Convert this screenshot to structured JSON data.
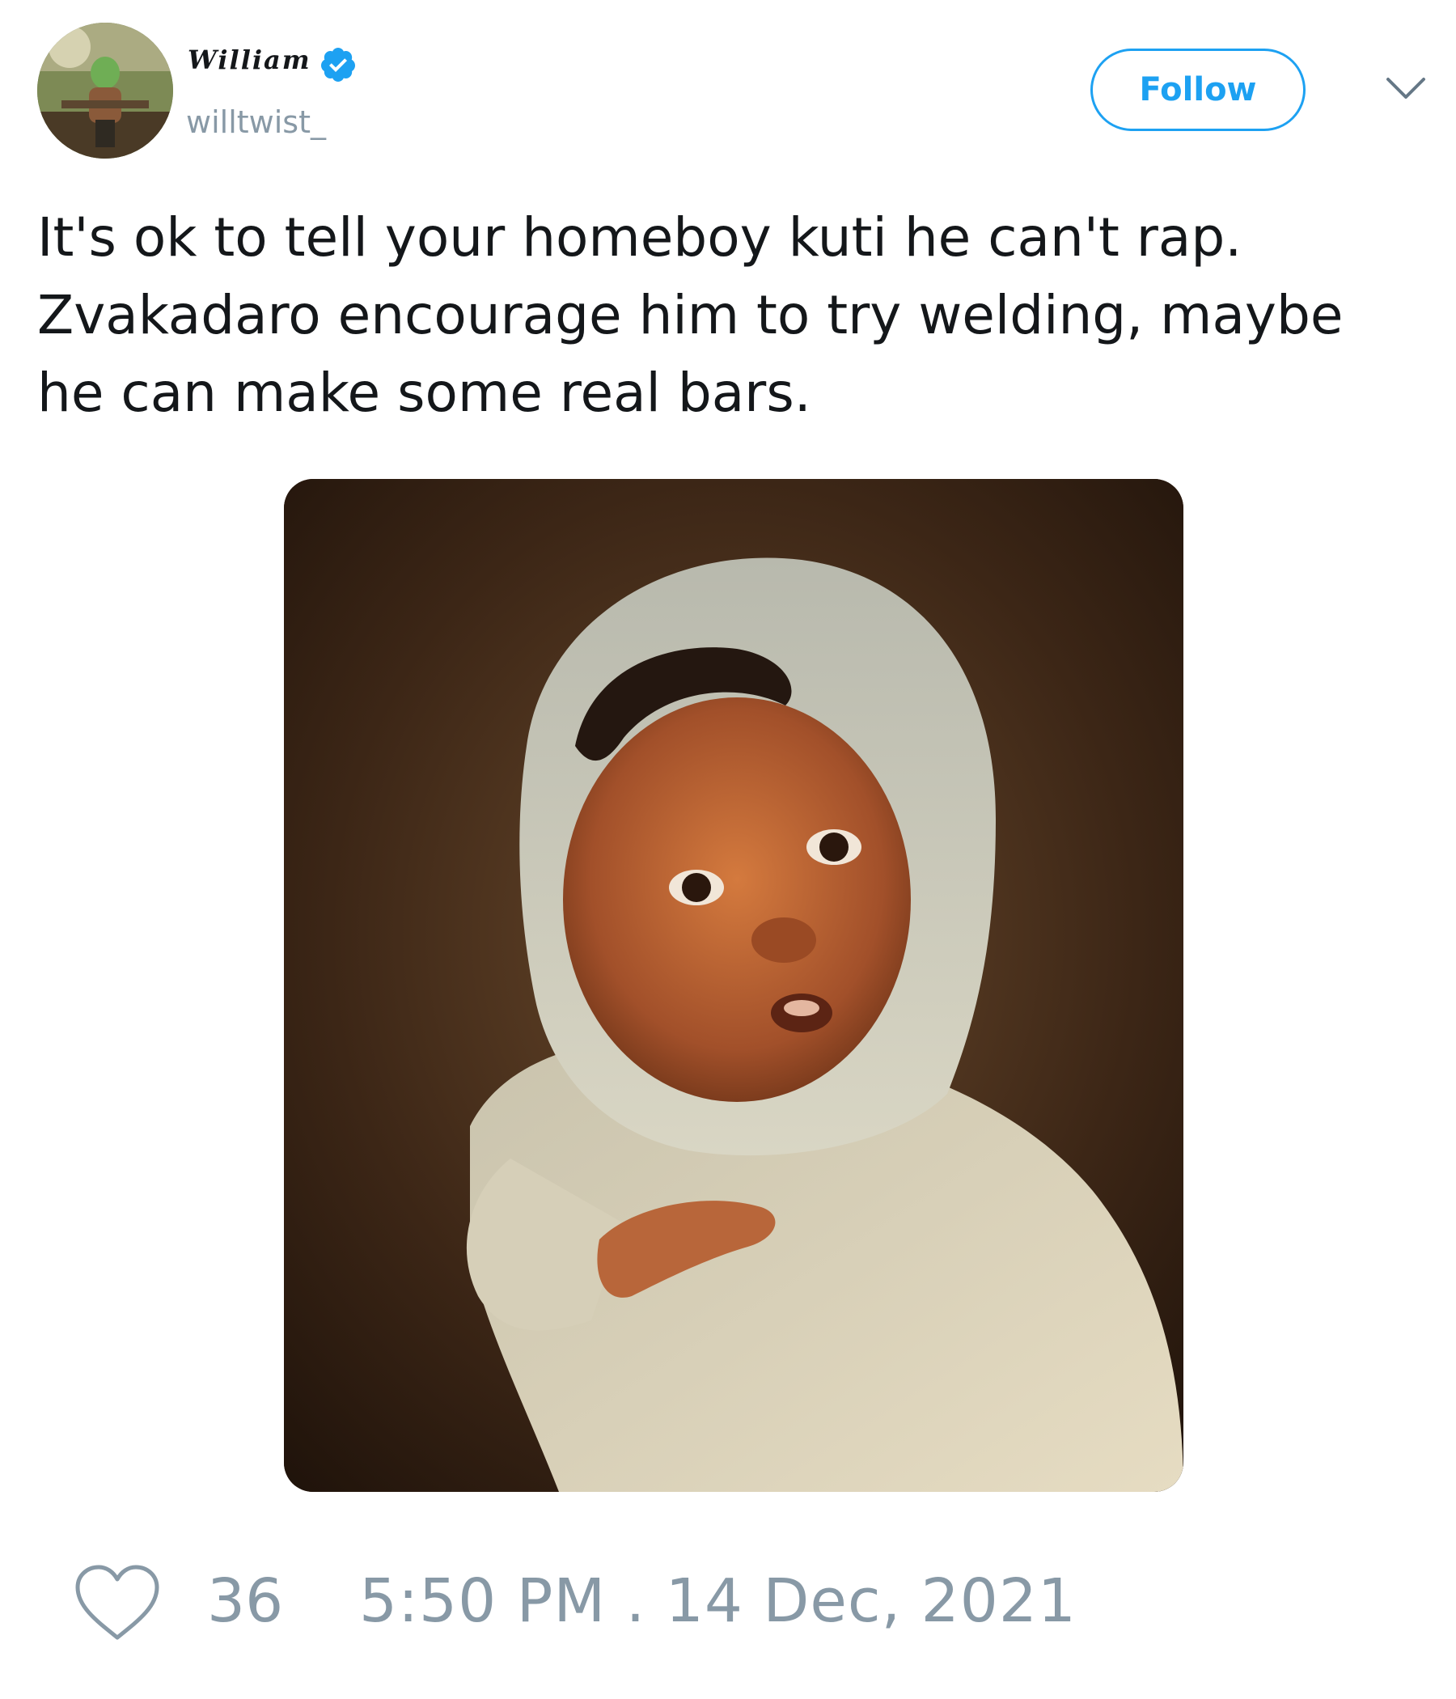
{
  "author": {
    "display_name": "William",
    "handle": "willtwist_",
    "verified": true
  },
  "header": {
    "follow_label": "Follow"
  },
  "tweet": {
    "text": "It's ok to tell your homeboy kuti he can't rap.\nZvakadaro encourage him to try welding, maybe\nhe can make some real bars."
  },
  "footer": {
    "like_count": "36",
    "timestamp": "5:50 PM . 14 Dec, 2021"
  },
  "colors": {
    "accent": "#1da1f2",
    "muted": "#8899a6",
    "text": "#14171a"
  },
  "icons": {
    "verified": "verified-badge-icon",
    "menu": "chevron-down-icon",
    "like": "heart-icon"
  }
}
